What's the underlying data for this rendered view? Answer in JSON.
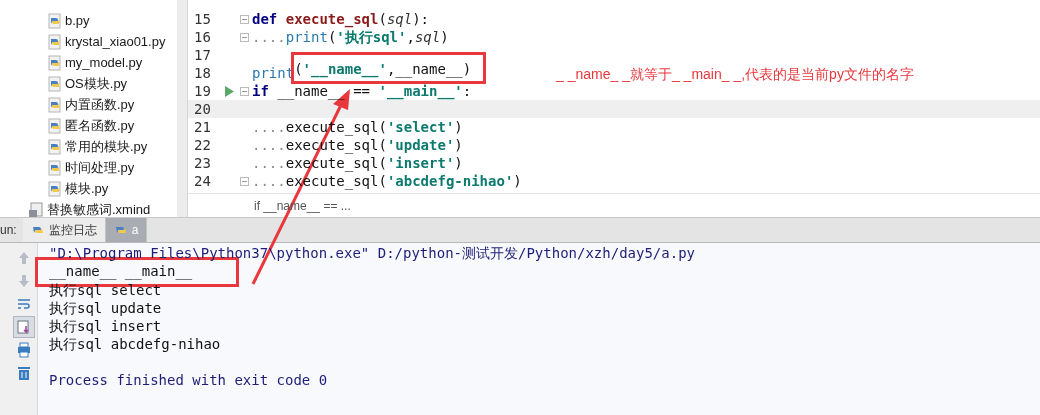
{
  "project_tree": [
    {
      "children": [
        {
          "name": "b.py",
          "kind": "py"
        },
        {
          "name": "krystal_xiao01.py",
          "kind": "py"
        },
        {
          "name": "my_model.py",
          "kind": "py"
        },
        {
          "name": "OS模块.py",
          "kind": "py"
        },
        {
          "name": "内置函数.py",
          "kind": "py"
        },
        {
          "name": "匿名函数.py",
          "kind": "py"
        },
        {
          "name": "常用的模块.py",
          "kind": "py"
        },
        {
          "name": "时间处理.py",
          "kind": "py"
        },
        {
          "name": "模块.py",
          "kind": "py"
        }
      ]
    },
    {
      "name": "替换敏感词.xmind",
      "kind": "xmind"
    }
  ],
  "editor": {
    "lines": [
      {
        "number": "15",
        "current": false,
        "run_marker": false,
        "fold": true,
        "tokens": [
          {
            "text": "def ",
            "kind": "keyword"
          },
          {
            "text": "execute_sql",
            "kind": "function"
          },
          {
            "text": "(",
            "kind": "plain"
          },
          {
            "text": "sql",
            "kind": "param"
          },
          {
            "text": "):",
            "kind": "plain"
          }
        ]
      },
      {
        "number": "16",
        "current": false,
        "run_marker": false,
        "fold": true,
        "tokens": [
          {
            "text": "....",
            "kind": "whitespace"
          },
          {
            "text": "print",
            "kind": "builtin"
          },
          {
            "text": "(",
            "kind": "plain"
          },
          {
            "text": "'执行sql'",
            "kind": "string"
          },
          {
            "text": ",",
            "kind": "plain"
          },
          {
            "text": "sql",
            "kind": "param"
          },
          {
            "text": ")",
            "kind": "plain"
          }
        ]
      },
      {
        "number": "17",
        "current": false,
        "run_marker": false,
        "fold": false
      },
      {
        "number": "18",
        "current": false,
        "run_marker": false,
        "fold": false,
        "tokens": [
          {
            "text": "print",
            "kind": "builtin"
          },
          {
            "text": "(",
            "kind": "plain",
            "boxed": true
          },
          {
            "text": "'__name__'",
            "kind": "string",
            "boxed": true
          },
          {
            "text": ",__name__)",
            "kind": "plain",
            "boxed": true
          }
        ]
      },
      {
        "number": "19",
        "current": false,
        "run_marker": true,
        "fold": true,
        "tokens": [
          {
            "text": "if ",
            "kind": "keyword"
          },
          {
            "text": "__name__ == ",
            "kind": "plain"
          },
          {
            "text": "'__main__'",
            "kind": "string"
          },
          {
            "text": ":",
            "kind": "plain"
          }
        ]
      },
      {
        "number": "20",
        "current": true,
        "run_marker": false,
        "fold": false
      },
      {
        "number": "21",
        "current": false,
        "run_marker": false,
        "fold": false,
        "tokens": [
          {
            "text": "....",
            "kind": "whitespace"
          },
          {
            "text": "execute_sql(",
            "kind": "plain"
          },
          {
            "text": "'select'",
            "kind": "string"
          },
          {
            "text": ")",
            "kind": "plain"
          }
        ]
      },
      {
        "number": "22",
        "current": false,
        "run_marker": false,
        "fold": false,
        "tokens": [
          {
            "text": "....",
            "kind": "whitespace"
          },
          {
            "text": "execute_sql(",
            "kind": "plain"
          },
          {
            "text": "'update'",
            "kind": "string"
          },
          {
            "text": ")",
            "kind": "plain"
          }
        ]
      },
      {
        "number": "23",
        "current": false,
        "run_marker": false,
        "fold": false,
        "tokens": [
          {
            "text": "....",
            "kind": "whitespace"
          },
          {
            "text": "execute_sql(",
            "kind": "plain"
          },
          {
            "text": "'insert'",
            "kind": "string"
          },
          {
            "text": ")",
            "kind": "plain"
          }
        ]
      },
      {
        "number": "24",
        "current": false,
        "run_marker": false,
        "fold": true,
        "tokens": [
          {
            "text": "....",
            "kind": "whitespace"
          },
          {
            "text": "execute_sql(",
            "kind": "plain"
          },
          {
            "text": "'abcdefg-nihao'",
            "kind": "string"
          },
          {
            "text": ")",
            "kind": "plain"
          }
        ]
      }
    ],
    "breadcrumb": "if __name__ == ..."
  },
  "annotation": "_ _name_ _就等于_ _main_ _,代表的是当前py文件的名字",
  "run_panel": {
    "label": "un:",
    "tabs": [
      {
        "label": "监控日志",
        "selected": false
      },
      {
        "label": "a",
        "selected": true
      }
    ],
    "toolbar": [
      {
        "kind": "up",
        "selected": false
      },
      {
        "kind": "down",
        "selected": false
      },
      {
        "kind": "wrap",
        "selected": false
      },
      {
        "kind": "scroll",
        "selected": true
      },
      {
        "kind": "print",
        "selected": false
      },
      {
        "kind": "trash",
        "selected": false
      }
    ],
    "output": [
      {
        "text": "\"D:\\Program Files\\Python37\\python.exe\" D:/python-测试开发/Python/xzh/day5/a.py",
        "kind": "system"
      },
      {
        "text": "__name__ __main__",
        "kind": "stdout",
        "boxed": true
      },
      {
        "text": "执行sql select",
        "kind": "stdout"
      },
      {
        "text": "执行sql update",
        "kind": "stdout"
      },
      {
        "text": "执行sql insert",
        "kind": "stdout"
      },
      {
        "text": "执行sql abcdefg-nihao",
        "kind": "stdout"
      },
      {
        "kind": "blank"
      },
      {
        "text": "Process finished with exit code 0",
        "kind": "system"
      }
    ]
  }
}
